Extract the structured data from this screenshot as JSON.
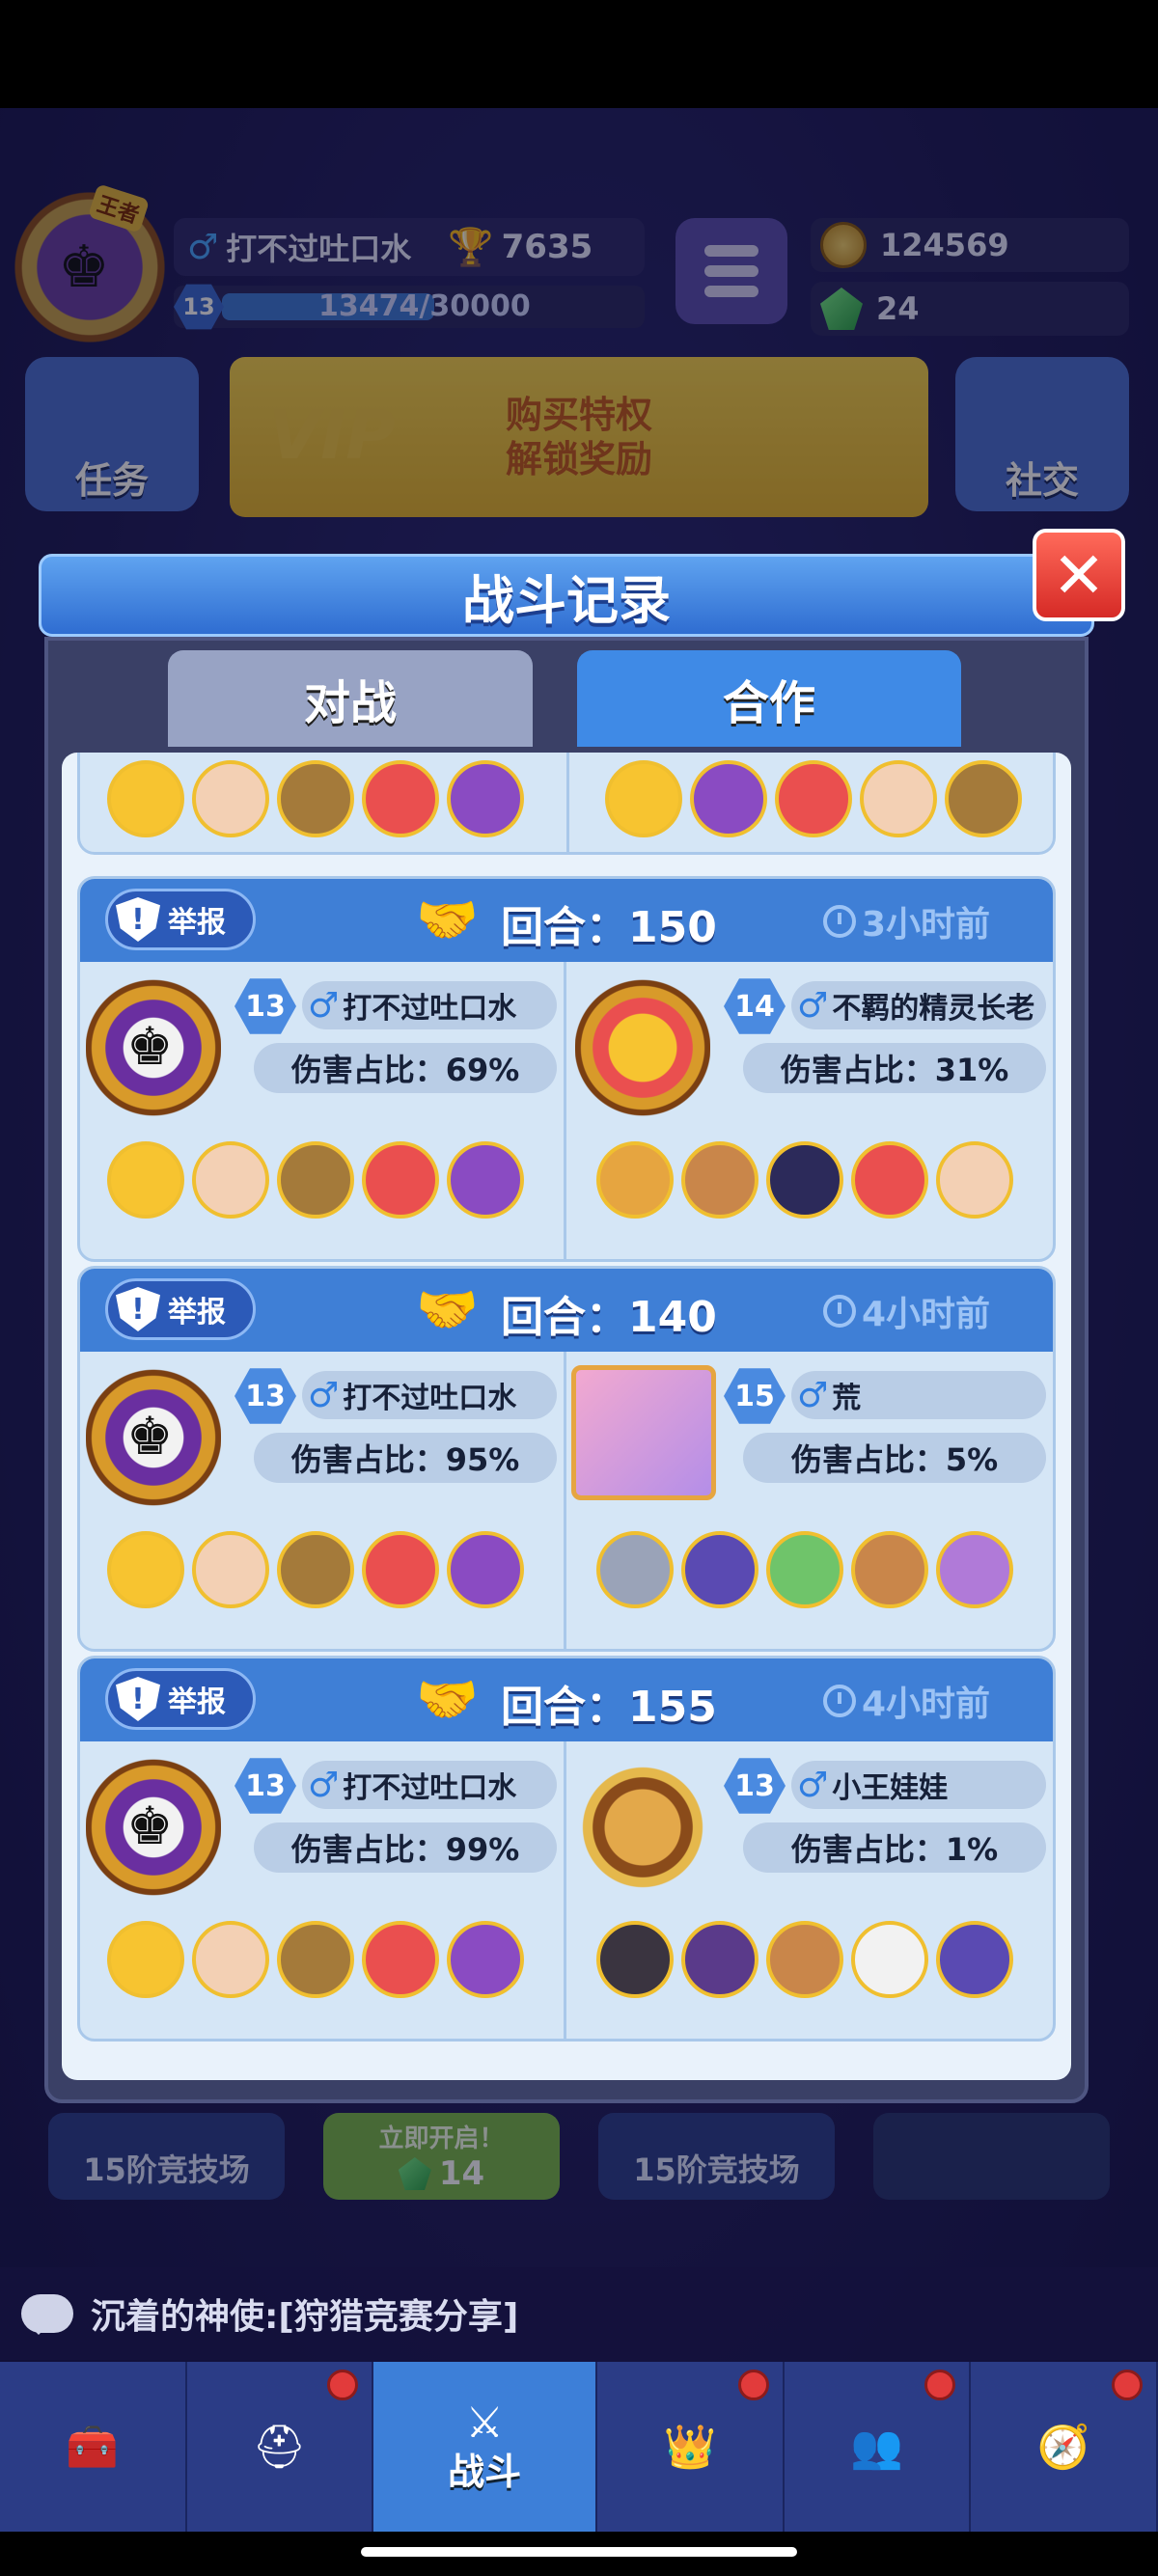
{
  "player": {
    "name": "打不过吐口水",
    "rank_tag": "王者",
    "level": "13",
    "trophies": "7635",
    "xp": "13474/30000",
    "xp_progress": 0.45
  },
  "currency": {
    "coins": "124569",
    "gems": "24"
  },
  "hud": {
    "task_label": "任务",
    "social_label": "社交",
    "vip_line1": "购买特权",
    "vip_line2": "解锁奖励",
    "vip_mark": "VIP"
  },
  "modal": {
    "title": "战斗记录",
    "close_icon": "close-icon",
    "tabs": [
      {
        "label": "对战",
        "active": false
      },
      {
        "label": "合作",
        "active": true
      }
    ],
    "report_label": "举报",
    "round_prefix": "回合：",
    "records": [
      {
        "round": "150",
        "time": "3小时前",
        "left": {
          "level": "13",
          "name": "打不过吐口水",
          "damage": "伤害占比：69%",
          "avatar": "king-silhouette"
        },
        "right": {
          "level": "14",
          "name": "不羁的精灵长老",
          "damage": "伤害占比：31%",
          "avatar": "duck-badge"
        }
      },
      {
        "round": "140",
        "time": "4小时前",
        "left": {
          "level": "13",
          "name": "打不过吐口水",
          "damage": "伤害占比：95%",
          "avatar": "king-silhouette"
        },
        "right": {
          "level": "15",
          "name": "荒",
          "damage": "伤害占比：5%",
          "avatar": "anniversary-girl"
        }
      },
      {
        "round": "155",
        "time": "4小时前",
        "left": {
          "level": "13",
          "name": "打不过吐口水",
          "damage": "伤害占比：99%",
          "avatar": "king-silhouette"
        },
        "right": {
          "level": "13",
          "name": "小王娃娃",
          "damage": "伤害占比：1%",
          "avatar": "monkey-king"
        }
      }
    ]
  },
  "lobby": {
    "arena_left": "15阶竞技场",
    "arena_right": "15阶竞技场",
    "open_now": "立即开启！",
    "open_cost": "14"
  },
  "chat": {
    "text": "沉着的神使:[狩猎竞赛分享]"
  },
  "nav": {
    "battle_label": "战斗"
  },
  "colors": {
    "accent": "#3f7fd6",
    "panel": "#e9f2fb",
    "gold": "#f0bf2f",
    "close": "#d62a26"
  }
}
